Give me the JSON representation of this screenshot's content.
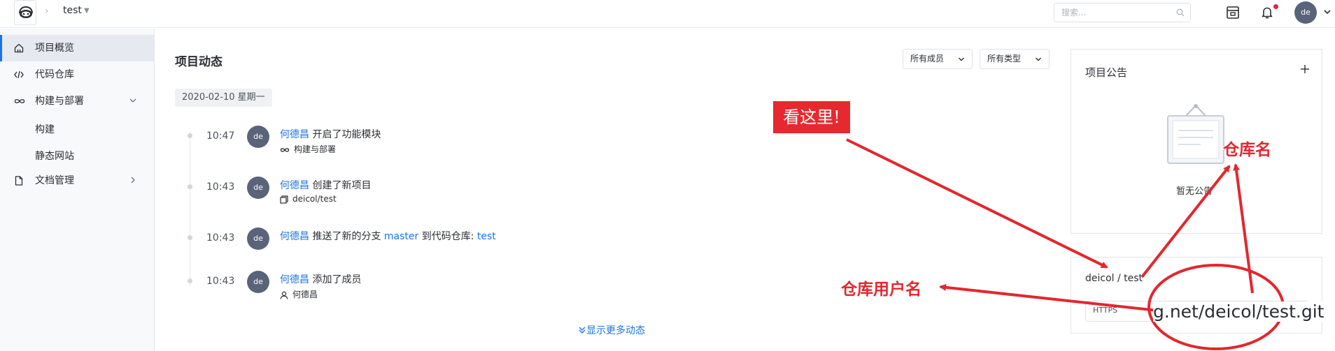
{
  "topbar": {
    "project_name": "test",
    "search_placeholder": "搜索...",
    "avatar_initials": "de"
  },
  "sidebar": {
    "items": [
      {
        "label": "项目概览",
        "icon": "home-icon",
        "active": true
      },
      {
        "label": "代码仓库",
        "icon": "code-icon"
      },
      {
        "label": "构建与部署",
        "icon": "infinity-icon"
      },
      {
        "label": "构建"
      },
      {
        "label": "静态网站"
      },
      {
        "label": "文档管理",
        "icon": "document-icon"
      }
    ]
  },
  "main": {
    "title": "项目动态",
    "filter_members": "所有成员",
    "filter_types": "所有类型",
    "date": "2020-02-10 星期一",
    "activities": [
      {
        "time": "10:47",
        "avatar": "de",
        "user": "何德昌",
        "action": "开启了功能模块",
        "sub": "构建与部署",
        "sub_icon": "infinity-icon"
      },
      {
        "time": "10:43",
        "avatar": "de",
        "user": "何德昌",
        "action": "创建了新项目",
        "sub": "deicol/test",
        "sub_icon": "copy-icon"
      },
      {
        "time": "10:43",
        "avatar": "de",
        "user": "何德昌",
        "action": "推送了新的分支",
        "branch": "master",
        "action2": "到代码仓库:",
        "repo": "test"
      },
      {
        "time": "10:43",
        "avatar": "de",
        "user": "何德昌",
        "action": "添加了成员",
        "sub": "何德昌",
        "sub_icon": "user-icon"
      }
    ],
    "show_more": "显示更多动态"
  },
  "right": {
    "notice_title": "项目公告",
    "empty_text": "暂无公告",
    "repo_name": "deicol / test",
    "repo_protocol": "HTTPS",
    "repo_url_zoom": "g.net/deicol/test.git"
  },
  "annotations": {
    "look_here": "看这里!",
    "repo_name_label": "仓库名",
    "repo_user_label": "仓库用户名"
  },
  "colors": {
    "accent": "#1b72e8",
    "annotation_red": "#e2272e",
    "avatar_bg": "#59647b"
  }
}
